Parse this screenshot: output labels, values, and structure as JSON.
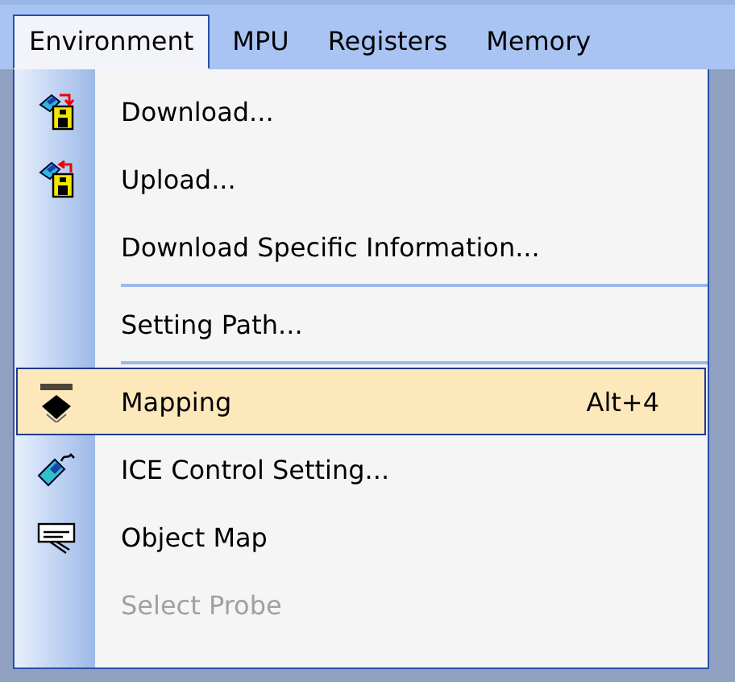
{
  "menubar": [
    {
      "label": "Environment",
      "selected": true
    },
    {
      "label": "MPU",
      "selected": false
    },
    {
      "label": "Registers",
      "selected": false
    },
    {
      "label": "Memory",
      "selected": false
    }
  ],
  "menu": [
    {
      "kind": "item",
      "label": "Download...",
      "selected": false,
      "disabled": false
    },
    {
      "kind": "item",
      "label": "Upload...",
      "selected": false,
      "disabled": false
    },
    {
      "kind": "item",
      "label": "Download Specific Information...",
      "selected": false,
      "disabled": false
    },
    {
      "kind": "separator"
    },
    {
      "kind": "item",
      "label": "Setting Path...",
      "selected": false,
      "disabled": false
    },
    {
      "kind": "separator"
    },
    {
      "kind": "item",
      "label": "Mapping",
      "shortcut": "Alt+4",
      "selected": true,
      "disabled": false
    },
    {
      "kind": "item",
      "label": "ICE Control Setting...",
      "selected": false,
      "disabled": false
    },
    {
      "kind": "item",
      "label": "Object Map",
      "selected": false,
      "disabled": false
    },
    {
      "kind": "item",
      "label": "Select Probe",
      "selected": false,
      "disabled": true
    }
  ]
}
